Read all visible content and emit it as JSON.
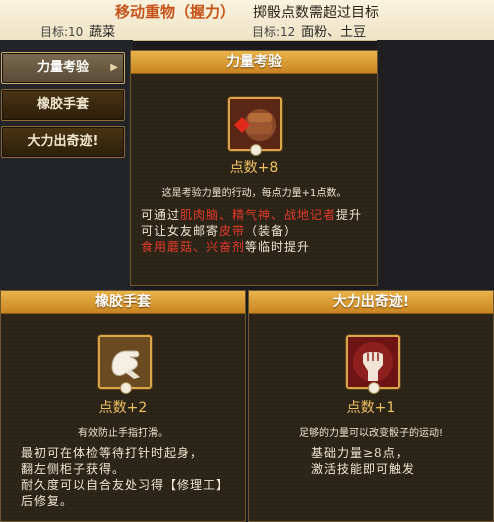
{
  "header": {
    "title": "移动重物（握力）",
    "subtitle": "掷骰点数需超过目标",
    "targets": [
      {
        "label": "目标:10",
        "value": "蔬菜"
      },
      {
        "label": "目标:12",
        "value": "面粉、土豆"
      }
    ]
  },
  "sidebar": {
    "items": [
      {
        "label": "力量考验",
        "active": true,
        "arrow": "▶"
      },
      {
        "label": "橡胶手套",
        "active": false
      },
      {
        "label": "大力出奇迹!",
        "active": false
      }
    ]
  },
  "main": {
    "title": "力量考验",
    "icon": "strength-fist-icon",
    "points": "点数+8",
    "description": "这是考验力量的行动，每点力量+1点数。",
    "line1_prefix": "可通过",
    "line1_red": "肌肉脑、精气神、战地记者",
    "line1_suffix": "提升",
    "line2_prefix": "可让女友邮寄",
    "line2_red": "皮带",
    "line2_suffix": "（装备）",
    "line3_red": "食用蘑菇、兴奋剂",
    "line3_suffix": "等临时提升"
  },
  "card_gloves": {
    "title": "橡胶手套",
    "icon": "rubber-glove-icon",
    "points": "点数+2",
    "description": "有效防止手指打滑。",
    "lines": [
      "最初可在体检等待打针时起身，",
      "翻左侧柜子获得。",
      "耐久度可以自合友处习得【修理工】",
      "后修复。"
    ]
  },
  "card_miracle": {
    "title": "大力出奇迹!",
    "icon": "raised-fist-icon",
    "points": "点数+1",
    "description": "足够的力量可以改变骰子的运动!",
    "lines": [
      "基础力量≥8点，",
      "激活技能即可触发"
    ]
  },
  "colors": {
    "accent": "#e9b44a",
    "highlight": "#e23a2a",
    "points": "#f0c060"
  }
}
